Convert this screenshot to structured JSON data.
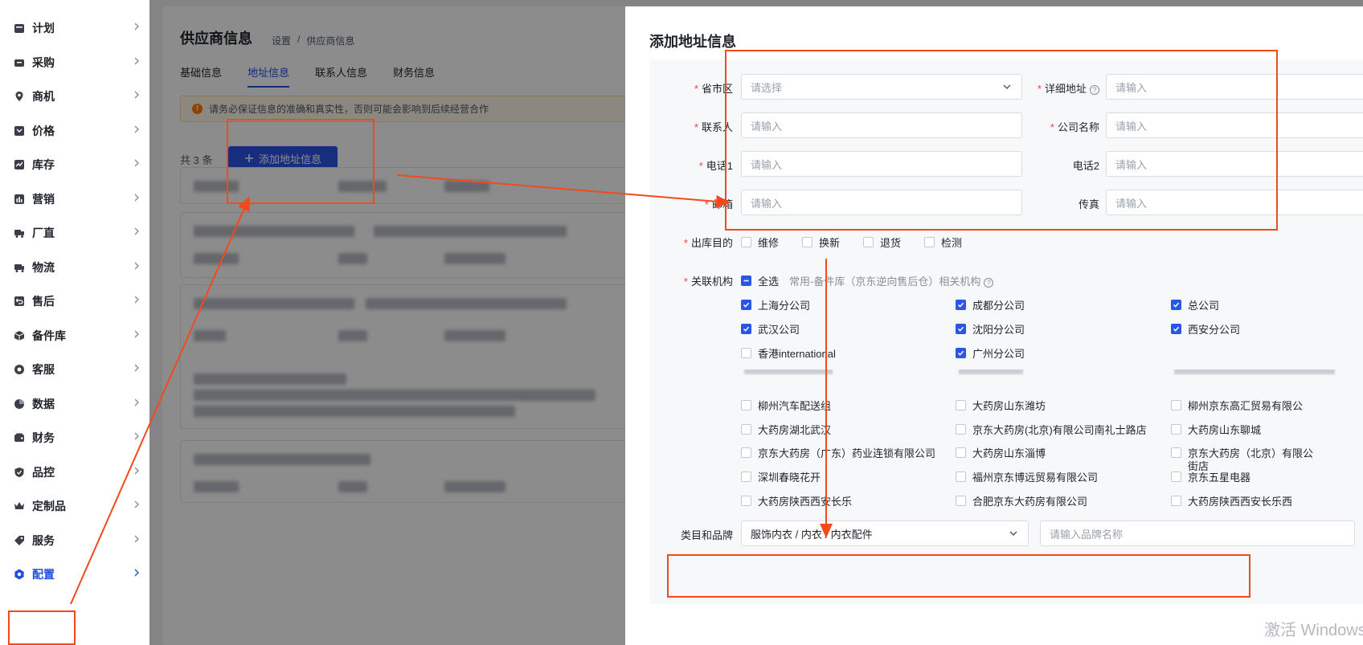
{
  "sidebar": {
    "items": [
      {
        "label": "计划",
        "icon": "calendar-icon"
      },
      {
        "label": "采购",
        "icon": "cart-icon"
      },
      {
        "label": "商机",
        "icon": "location-pin-icon"
      },
      {
        "label": "价格",
        "icon": "price-tag-icon"
      },
      {
        "label": "库存",
        "icon": "trend-icon"
      },
      {
        "label": "营销",
        "icon": "bar-chart-icon"
      },
      {
        "label": "厂直",
        "icon": "truck-icon"
      },
      {
        "label": "物流",
        "icon": "delivery-truck-icon"
      },
      {
        "label": "售后",
        "icon": "return-icon"
      },
      {
        "label": "备件库",
        "icon": "cube-icon"
      },
      {
        "label": "客服",
        "icon": "headset-icon"
      },
      {
        "label": "数据",
        "icon": "pie-chart-icon"
      },
      {
        "label": "财务",
        "icon": "wallet-icon"
      },
      {
        "label": "品控",
        "icon": "shield-check-icon"
      },
      {
        "label": "定制品",
        "icon": "crown-icon"
      },
      {
        "label": "服务",
        "icon": "tag-icon"
      },
      {
        "label": "配置",
        "icon": "settings-hex-icon"
      }
    ],
    "active": "配置"
  },
  "main": {
    "title": "供应商信息",
    "breadcrumb": [
      "设置",
      "/",
      "供应商信息"
    ],
    "tabs": [
      "基础信息",
      "地址信息",
      "联系人信息",
      "财务信息"
    ],
    "active_tab": "地址信息",
    "notice": "请务必保证信息的准确和真实性，否则可能会影响到后续经营合作",
    "count": "共 3 条",
    "add_button": "添加地址信息"
  },
  "drawer": {
    "title": "添加地址信息",
    "fields": {
      "region": {
        "label": "省市区",
        "placeholder": "请选择"
      },
      "address": {
        "label": "详细地址",
        "placeholder": "请输入"
      },
      "contact": {
        "label": "联系人",
        "placeholder": "请输入"
      },
      "company": {
        "label": "公司名称",
        "placeholder": "请输入"
      },
      "phone1": {
        "label": "电话1",
        "placeholder": "请输入"
      },
      "phone2": {
        "label": "电话2",
        "placeholder": "请输入"
      },
      "email": {
        "label": "邮箱",
        "placeholder": "请输入"
      },
      "fax": {
        "label": "传真",
        "placeholder": "请输入"
      }
    },
    "purpose": {
      "label": "出库目的",
      "options": [
        {
          "label": "维修",
          "checked": false
        },
        {
          "label": "换新",
          "checked": false
        },
        {
          "label": "退货",
          "checked": false
        },
        {
          "label": "检测",
          "checked": false
        }
      ]
    },
    "org": {
      "label": "关联机构",
      "select_all": "全选",
      "hint": "常用-备件库（京东逆向售后仓）相关机构",
      "checked_rows": [
        [
          {
            "label": "上海分公司",
            "checked": true
          },
          {
            "label": "成都分公司",
            "checked": true
          },
          {
            "label": "总公司",
            "checked": true
          }
        ],
        [
          {
            "label": "武汉公司",
            "checked": true
          },
          {
            "label": "沈阳分公司",
            "checked": true
          },
          {
            "label": "西安分公司",
            "checked": true
          }
        ],
        [
          {
            "label": "香港international",
            "checked": false
          },
          {
            "label": "广州分公司",
            "checked": true
          }
        ]
      ],
      "more_rows": [
        [
          "柳州汽车配送组",
          "大药房山东潍坊",
          "柳州京东高汇贸易有限公"
        ],
        [
          "大药房湖北武汉",
          "京东大药房(北京)有限公司南礼士路店",
          "大药房山东聊城"
        ],
        [
          "京东大药房（广东）药业连锁有限公司",
          "大药房山东淄博",
          "京东大药房（北京）有限公"
        ],
        [
          "深圳春晓花开",
          "福州京东博远贸易有限公司",
          "京东五星电器"
        ],
        [
          "大药房陕西西安长乐",
          "合肥京东大药房有限公司",
          "大药房陕西西安长乐西"
        ]
      ],
      "wrapped_tail": "街店"
    },
    "category": {
      "label": "类目和品牌",
      "value": "服饰内衣 / 内衣 / 内衣配件",
      "brand_placeholder": "请输入品牌名称"
    }
  },
  "watermark": "激活 Windows",
  "colors": {
    "primary": "#2b55e6",
    "annotation": "#f24a1a",
    "required": "#f53f3f"
  }
}
